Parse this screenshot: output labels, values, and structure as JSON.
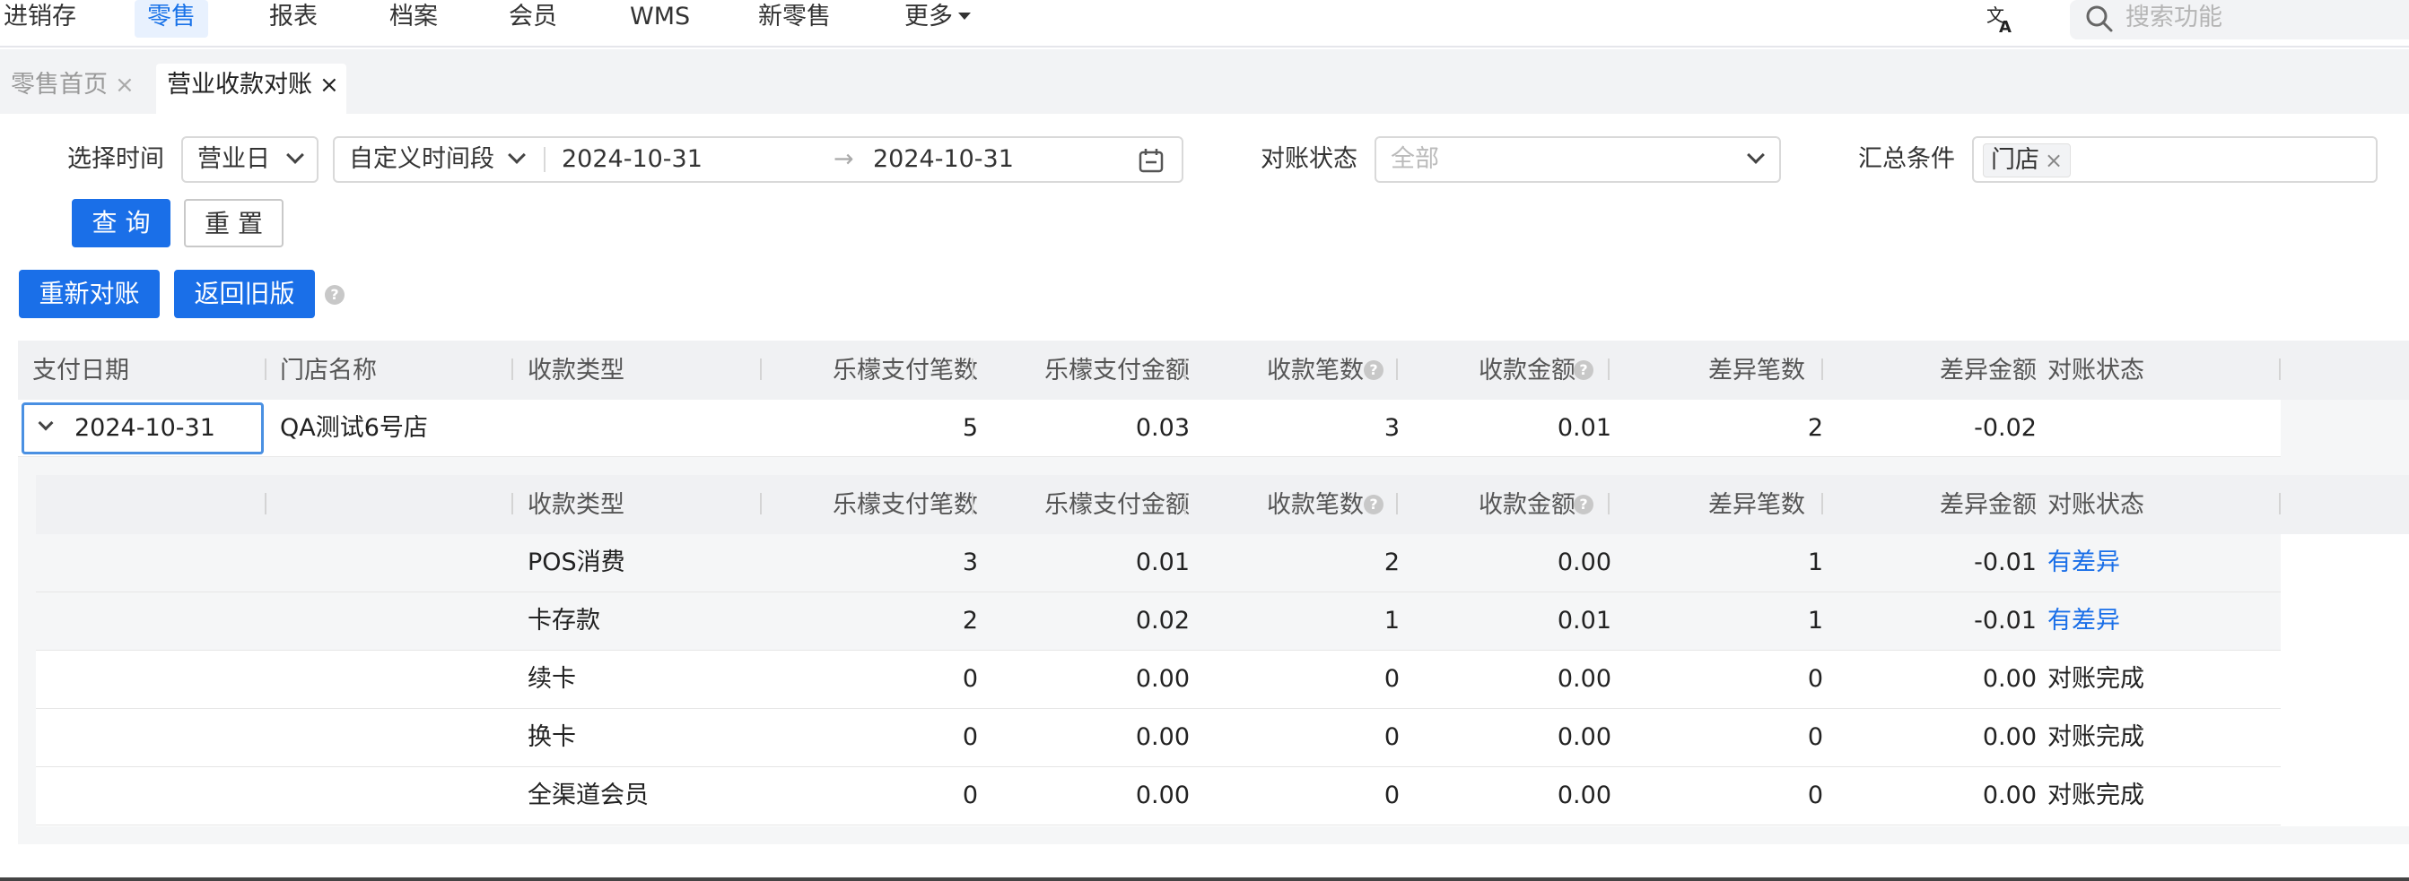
{
  "nav": {
    "items": [
      "进销存",
      "零售",
      "报表",
      "档案",
      "会员",
      "WMS",
      "新零售",
      "更多"
    ],
    "active": "零售",
    "search_placeholder": "搜索功能",
    "lang_icon": "translate-icon"
  },
  "tabs": [
    {
      "label": "零售首页",
      "close": "×"
    },
    {
      "label": "营业收款对账",
      "close": "×"
    }
  ],
  "filters": {
    "time_label": "选择时间",
    "time_type": "营业日",
    "range_type": "自定义时间段",
    "start_date": "2024-10-31",
    "arrow": "→",
    "end_date": "2024-10-31",
    "status_label": "对账状态",
    "status_placeholder": "全部",
    "summary_label": "汇总条件",
    "summary_tag": "门店",
    "summary_tag_close": "×"
  },
  "buttons": {
    "query": "查 询",
    "reset": "重 置",
    "reconcile": "重新对账",
    "back_old": "返回旧版",
    "help": "?"
  },
  "table": {
    "columns": [
      "支付日期",
      "门店名称",
      "收款类型",
      "乐檬支付笔数",
      "乐檬支付金额",
      "收款笔数",
      "收款金额",
      "差异笔数",
      "差异金额",
      "对账状态"
    ],
    "summary_row": {
      "date": "2024-10-31",
      "store": "QA测试6号店",
      "type": "",
      "lm_count": "5",
      "lm_amount": "0.03",
      "count": "3",
      "amount": "0.01",
      "diff_count": "2",
      "diff_amount": "-0.02",
      "status": ""
    },
    "detail_columns": [
      "收款类型",
      "乐檬支付笔数",
      "乐檬支付金额",
      "收款笔数",
      "收款金额",
      "差异笔数",
      "差异金额",
      "对账状态"
    ],
    "detail_rows": [
      {
        "type": "POS消费",
        "lm_count": "3",
        "lm_amount": "0.01",
        "count": "2",
        "amount": "0.00",
        "diff_count": "1",
        "diff_amount": "-0.01",
        "status": "有差异",
        "link": true
      },
      {
        "type": "卡存款",
        "lm_count": "2",
        "lm_amount": "0.02",
        "count": "1",
        "amount": "0.01",
        "diff_count": "1",
        "diff_amount": "-0.01",
        "status": "有差异",
        "link": true
      },
      {
        "type": "续卡",
        "lm_count": "0",
        "lm_amount": "0.00",
        "count": "0",
        "amount": "0.00",
        "diff_count": "0",
        "diff_amount": "0.00",
        "status": "对账完成",
        "link": false
      },
      {
        "type": "换卡",
        "lm_count": "0",
        "lm_amount": "0.00",
        "count": "0",
        "amount": "0.00",
        "diff_count": "0",
        "diff_amount": "0.00",
        "status": "对账完成",
        "link": false
      },
      {
        "type": "全渠道会员",
        "lm_count": "0",
        "lm_amount": "0.00",
        "count": "0",
        "amount": "0.00",
        "diff_count": "0",
        "diff_amount": "0.00",
        "status": "对账完成",
        "link": false
      }
    ]
  },
  "colors": {
    "primary": "#1a6fe8",
    "link": "#1a6fe8",
    "table_bg": "#f5f6f7"
  }
}
